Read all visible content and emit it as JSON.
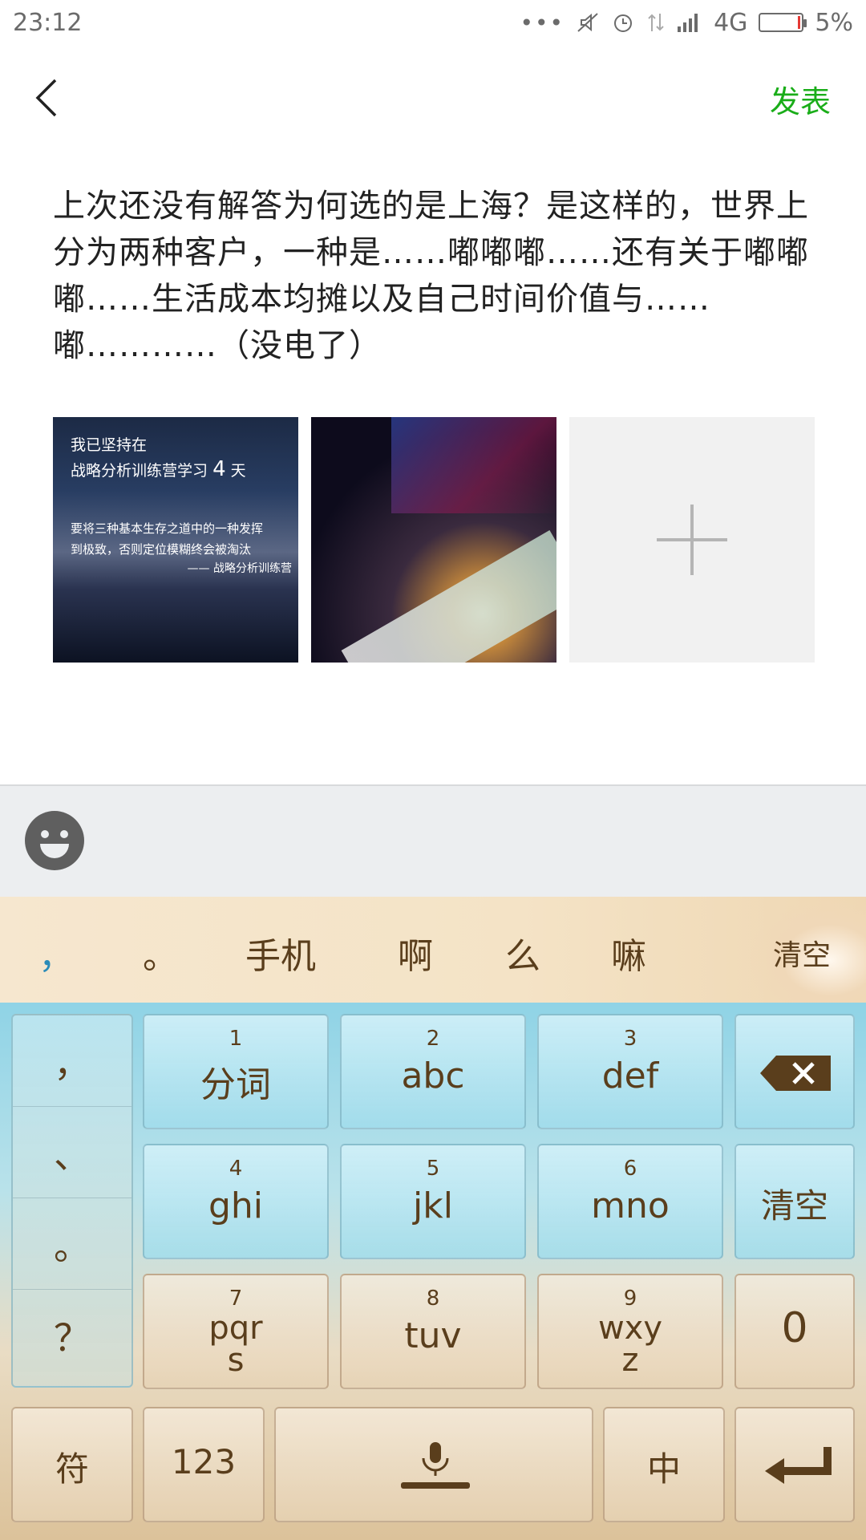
{
  "status_bar": {
    "time": "23:12",
    "network": "4G",
    "battery_percent": "5%",
    "battery_level": 0.05
  },
  "header": {
    "publish_label": "发表"
  },
  "post": {
    "text": "上次还没有解答为何选的是上海？是这样的，世界上分为两种客户，一种是……嘟嘟嘟……还有关于嘟嘟嘟……生活成本均摊以及自己时间价值与……嘟…………（没电了）"
  },
  "images": {
    "image1_lines": [
      "我已坚持在",
      "战略分析训练营学习",
      "4",
      "天"
    ],
    "image1_body": [
      "要将三种基本生存之道中的一种发挥",
      "到极致，否则定位模糊终会被淘汰"
    ],
    "image1_sign": "—— 战略分析训练营"
  },
  "candidates": {
    "items": [
      "，",
      "。",
      "手机",
      "啊",
      "么",
      "嘛"
    ],
    "clear": "清空"
  },
  "keyboard": {
    "punctuation": [
      "，",
      "、",
      "。",
      "？"
    ],
    "keys": [
      {
        "num": "1",
        "label": "分词"
      },
      {
        "num": "2",
        "label": "abc"
      },
      {
        "num": "3",
        "label": "def"
      },
      {
        "num": "4",
        "label": "ghi"
      },
      {
        "num": "5",
        "label": "jkl"
      },
      {
        "num": "6",
        "label": "mno"
      },
      {
        "num": "7",
        "label": "pqr",
        "label2": "s"
      },
      {
        "num": "8",
        "label": "tuv"
      },
      {
        "num": "9",
        "label": "wxy",
        "label2": "z"
      }
    ],
    "clear_label": "清空",
    "zero_label": "0",
    "symbol_label": "符",
    "num_label": "123",
    "lang_label": "中"
  }
}
